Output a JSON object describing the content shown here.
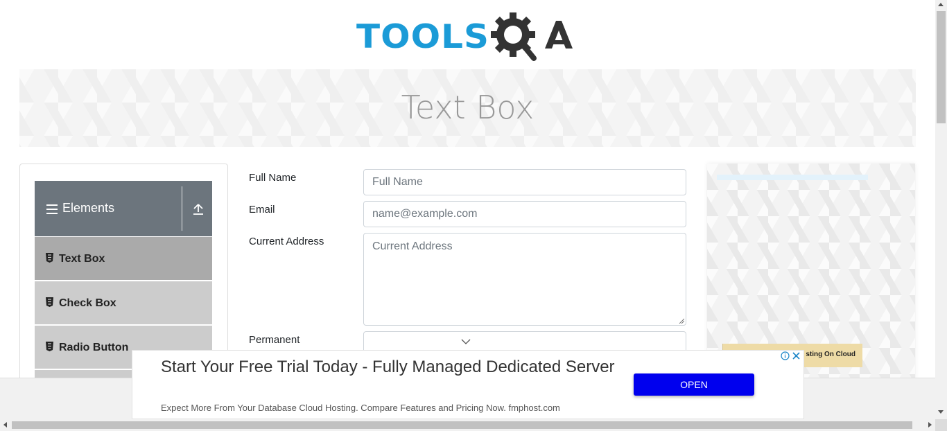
{
  "header": {
    "logo_text": "TOOLSQA"
  },
  "banner": {
    "title": "Text Box"
  },
  "sidebar": {
    "group_title": "Elements",
    "items": [
      {
        "label": "Text Box",
        "active": true
      },
      {
        "label": "Check Box",
        "active": false
      },
      {
        "label": "Radio Button",
        "active": false
      }
    ]
  },
  "form": {
    "full_name": {
      "label": "Full Name",
      "placeholder": "Full Name",
      "value": ""
    },
    "email": {
      "label": "Email",
      "placeholder": "name@example.com",
      "value": ""
    },
    "current_address": {
      "label": "Current Address",
      "placeholder": "Current Address",
      "value": ""
    },
    "permanent_address": {
      "label": "Permanent",
      "value": ""
    }
  },
  "side_ad": {
    "text": "sting On Cloud"
  },
  "bottom_ad": {
    "headline": "Start Your Free Trial Today - Fully Managed Dedicated Server",
    "subtext": "Expect More From Your Database Cloud Hosting. Compare Features and Pricing Now. fmphost.com",
    "button_label": "OPEN",
    "button_color": "#0000ee",
    "adchoices_icon": "info-icon",
    "close_icon": "close-icon"
  },
  "colors": {
    "brand_blue": "#1b9bd7",
    "brand_dark": "#333333",
    "sidebar_header": "#6c757d",
    "sidebar_item": "#cccccc",
    "sidebar_item_active": "#aaaaaa"
  }
}
